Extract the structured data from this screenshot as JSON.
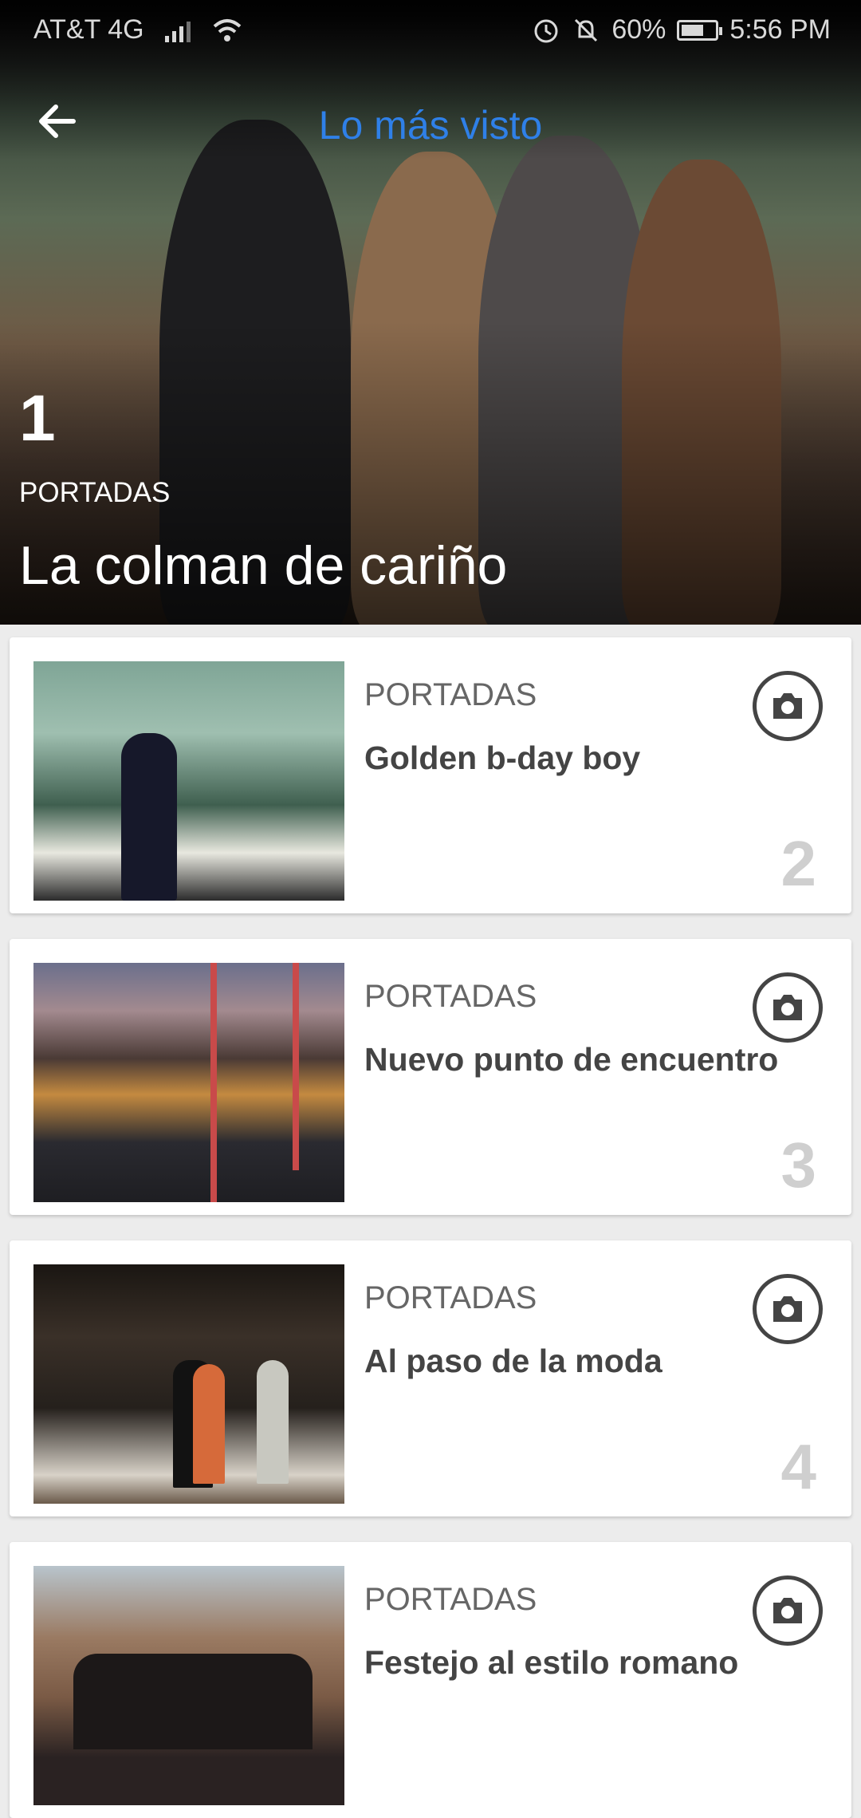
{
  "status_bar": {
    "carrier": "AT&T 4G",
    "battery": "60%",
    "time": "5:56 PM",
    "battery_level": 0.6
  },
  "toolbar": {
    "title": "Lo más visto",
    "back_icon": "arrow-left-icon"
  },
  "hero": {
    "rank": "1",
    "category": "PORTADAS",
    "title": "La colman de cariño"
  },
  "cards": [
    {
      "category": "PORTADAS",
      "title": "Golden b-day boy",
      "rank": "2",
      "icon": "camera-icon"
    },
    {
      "category": "PORTADAS",
      "title": "Nuevo punto de encuentro",
      "rank": "3",
      "icon": "camera-icon"
    },
    {
      "category": "PORTADAS",
      "title": "Al paso de la moda",
      "rank": "4",
      "icon": "camera-icon"
    },
    {
      "category": "PORTADAS",
      "title": "Festejo al estilo romano",
      "rank": "",
      "icon": "camera-icon"
    }
  ],
  "colors": {
    "accent": "#2f80e8",
    "rank_gray": "#cfcfcf",
    "text_dark": "#444444"
  }
}
